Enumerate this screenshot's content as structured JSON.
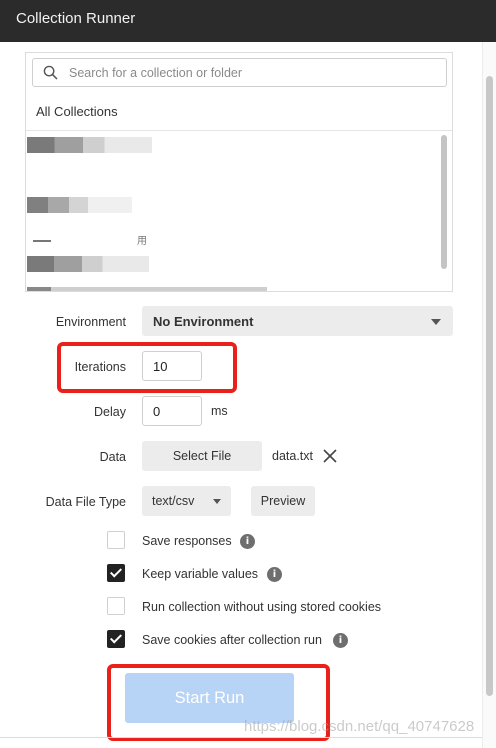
{
  "window": {
    "title": "Collection Runner"
  },
  "collections": {
    "search_placeholder": "Search for a collection or folder",
    "all_label": "All Collections",
    "item_suffix": "用"
  },
  "form": {
    "environment": {
      "label": "Environment",
      "value": "No Environment"
    },
    "iterations": {
      "label": "Iterations",
      "value": "10"
    },
    "delay": {
      "label": "Delay",
      "value": "0",
      "unit": "ms"
    },
    "data": {
      "label": "Data",
      "button": "Select File",
      "file_name": "data.txt"
    },
    "data_file_type": {
      "label": "Data File Type",
      "value": "text/csv",
      "preview_button": "Preview"
    }
  },
  "options": [
    {
      "label": "Save responses",
      "checked": false,
      "info": true
    },
    {
      "label": "Keep variable values",
      "checked": true,
      "info": true
    },
    {
      "label": "Run collection without using stored cookies",
      "checked": false,
      "info": false
    },
    {
      "label": "Save cookies after collection run",
      "checked": true,
      "info": true
    }
  ],
  "actions": {
    "start_run": "Start Run"
  },
  "watermark": "https://blog.csdn.net/qq_40747628",
  "colors": {
    "titlebar": "#2b2b2b",
    "start_button": "#b7d3f5",
    "highlight": "#e8211a",
    "checkbox_checked": "#222222"
  }
}
